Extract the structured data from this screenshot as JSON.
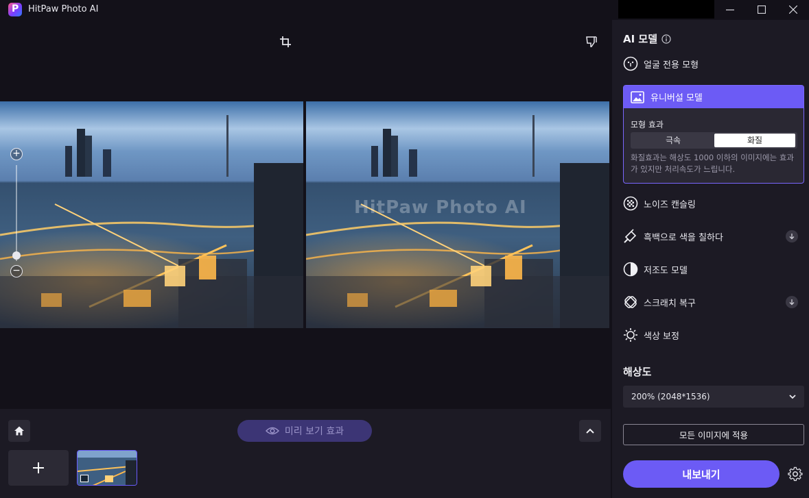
{
  "app": {
    "title": "HitPaw Photo AI",
    "logo_letter": "P"
  },
  "preview": {
    "watermark": "HitPaw Photo AI"
  },
  "bottom": {
    "preview_effect_label": "미리 보기 효과"
  },
  "sidebar": {
    "ai_model_title": "AI 모델",
    "models": [
      {
        "label": "얼굴 전용 모형",
        "icon": "face-icon",
        "download": false
      },
      {
        "label": "유니버설 모델",
        "icon": "image-icon",
        "download": false,
        "selected": true
      },
      {
        "label": "노이즈 캔슬링",
        "icon": "noise-icon",
        "download": false
      },
      {
        "label": "흑백으로 색을 칠하다",
        "icon": "paint-bucket-icon",
        "download": true
      },
      {
        "label": "저조도 모델",
        "icon": "contrast-icon",
        "download": false
      },
      {
        "label": "스크래치 복구",
        "icon": "bandage-icon",
        "download": true
      },
      {
        "label": "색상 보정",
        "icon": "brightness-icon",
        "download": false
      }
    ],
    "effect": {
      "label": "모형 효과",
      "options": [
        "극속",
        "화질"
      ],
      "selected": "화질",
      "description": "화질효과는 해상도 1000 이하의 이미지에는 효과가 있지만 처리속도가 느립니다."
    },
    "resolution_title": "해상도",
    "resolution_value": "200% (2048*1536)",
    "apply_all_label": "모든 이미지에 적용",
    "export_label": "내보내기"
  },
  "colors": {
    "accent": "#6c5bf5",
    "background": "#131119",
    "panel": "#1c1a24"
  }
}
